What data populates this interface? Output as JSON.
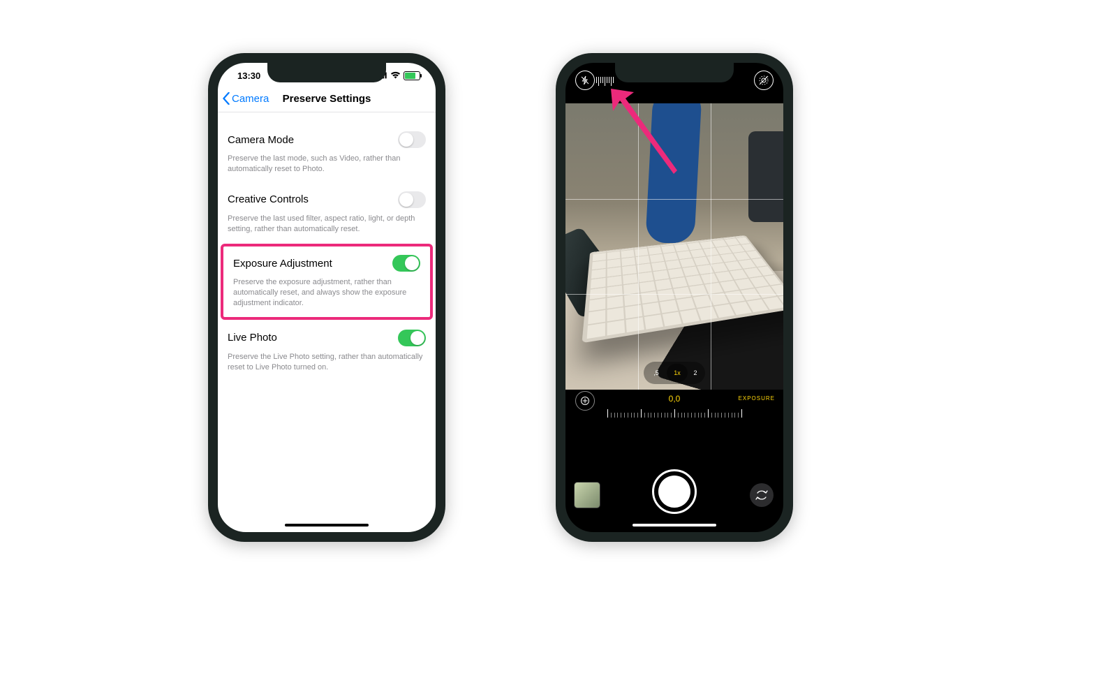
{
  "left": {
    "status_time": "13:30",
    "back_label": "Camera",
    "title": "Preserve Settings",
    "rows": [
      {
        "label": "Camera Mode",
        "on": false,
        "foot": "Preserve the last mode, such as Video, rather than automatically reset to Photo.",
        "highlight": false
      },
      {
        "label": "Creative Controls",
        "on": false,
        "foot": "Preserve the last used filter, aspect ratio, light, or depth setting, rather than automatically reset.",
        "highlight": false
      },
      {
        "label": "Exposure Adjustment",
        "on": true,
        "foot": "Preserve the exposure adjustment, rather than automatically reset, and always show the exposure adjustment indicator.",
        "highlight": true
      },
      {
        "label": "Live Photo",
        "on": true,
        "foot": "Preserve the Live Photo setting, rather than automatically reset to Live Photo turned on.",
        "highlight": false
      }
    ]
  },
  "right": {
    "exposure_value": "0,0",
    "exposure_label": "EXPOSURE",
    "zoom": {
      "options": [
        ",5",
        "1x",
        "2"
      ],
      "active_index": 1
    }
  },
  "colors": {
    "accent_green": "#34c759",
    "accent_blue": "#007aff",
    "highlight_pink": "#ec2a7b",
    "camera_yellow": "#ffd60a"
  }
}
